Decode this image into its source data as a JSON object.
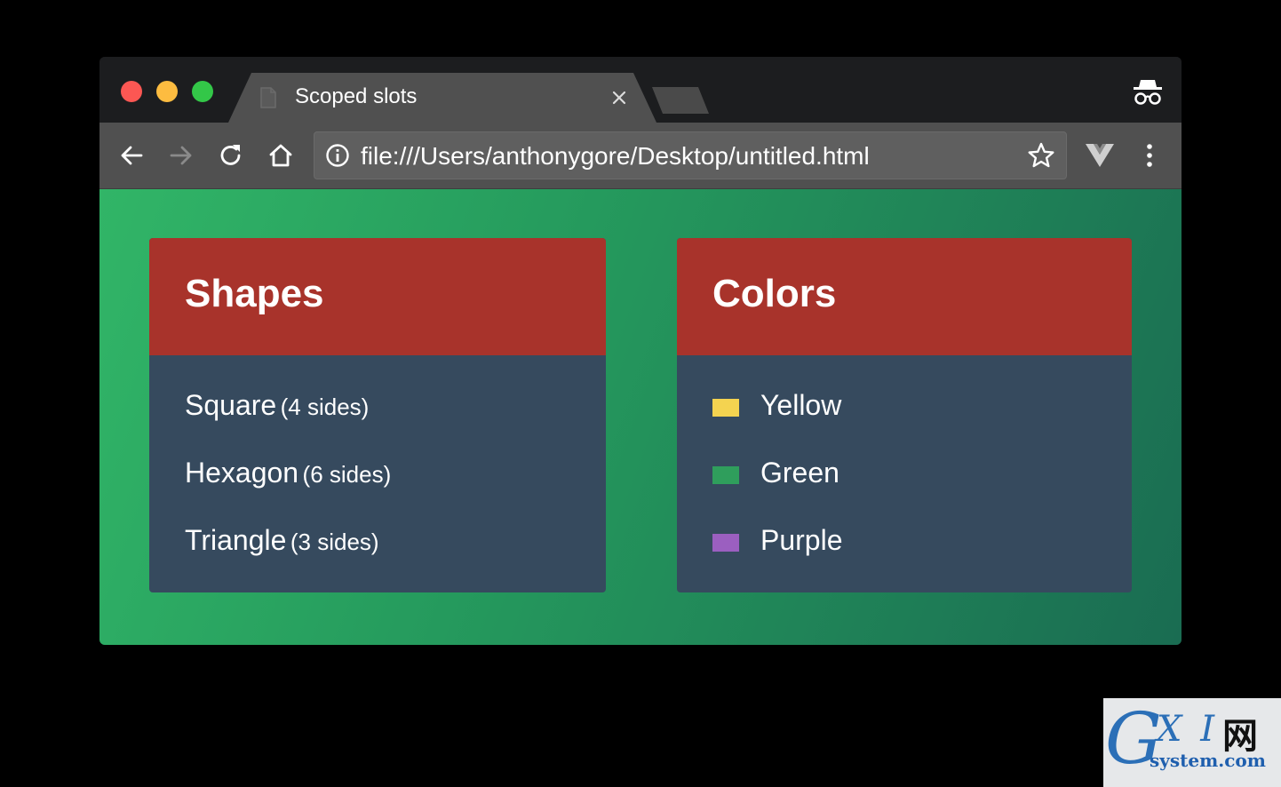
{
  "browser": {
    "tab_title": "Scoped slots",
    "url": "file:///Users/anthonygore/Desktop/untitled.html"
  },
  "shapes_card": {
    "title": "Shapes",
    "items": [
      {
        "name": "Square",
        "sides": "(4 sides)"
      },
      {
        "name": "Hexagon",
        "sides": "(6 sides)"
      },
      {
        "name": "Triangle",
        "sides": "(3 sides)"
      }
    ]
  },
  "colors_card": {
    "title": "Colors",
    "items": [
      {
        "name": "Yellow",
        "swatch": "#f4d350"
      },
      {
        "name": "Green",
        "swatch": "#2f9e5c"
      },
      {
        "name": "Purple",
        "swatch": "#9b5fc0"
      }
    ]
  },
  "watermark": {
    "g": "G",
    "xi": "X I",
    "wang": "网",
    "site": "system.com"
  },
  "colors": {
    "card_header": "#a8332b",
    "card_body": "#364a5e",
    "background_start": "#31b567",
    "background_end": "#1a6c52"
  },
  "icons": [
    "close-icon",
    "back-arrow-icon",
    "forward-arrow-icon",
    "reload-icon",
    "home-icon",
    "info-icon",
    "star-icon",
    "vue-devtools-icon",
    "menu-dots-icon",
    "incognito-icon",
    "document-icon"
  ]
}
